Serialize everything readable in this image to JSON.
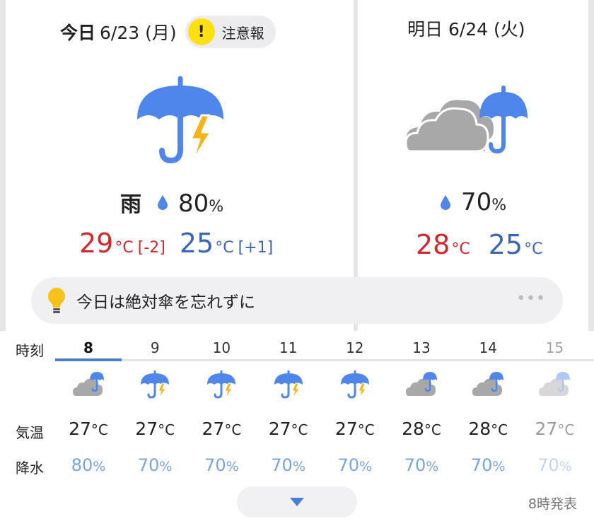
{
  "today": {
    "label": "今日",
    "date": "6/23 (月)",
    "alert": {
      "icon": "exclamation-icon",
      "label": "注意報"
    },
    "icon": "umbrella-lightning-icon",
    "weather": "雨",
    "pop": "80",
    "pop_unit": "%",
    "high": "29",
    "high_diff": "[-2]",
    "low": "25",
    "low_diff": "[+1]",
    "temp_unit": "°C"
  },
  "tomorrow": {
    "date": "明日 6/24 (火)",
    "icon": "cloud-umbrella-icon",
    "pop": "70",
    "pop_unit": "%",
    "high": "28",
    "low": "25",
    "temp_unit": "°C"
  },
  "tip": {
    "icon": "lightbulb-icon",
    "text": "今日は絶対傘を忘れずに",
    "more": "•••"
  },
  "hourly": {
    "time_label": "時刻",
    "temp_label": "気温",
    "precip_label": "降水",
    "hours": [
      {
        "hour": "8",
        "icon": "cloud-umbrella-icon",
        "temp": "27",
        "pop": "80"
      },
      {
        "hour": "9",
        "icon": "umbrella-lightning-icon",
        "temp": "27",
        "pop": "70"
      },
      {
        "hour": "10",
        "icon": "umbrella-lightning-icon",
        "temp": "27",
        "pop": "70"
      },
      {
        "hour": "11",
        "icon": "umbrella-lightning-icon",
        "temp": "27",
        "pop": "70"
      },
      {
        "hour": "12",
        "icon": "umbrella-lightning-icon",
        "temp": "27",
        "pop": "70"
      },
      {
        "hour": "13",
        "icon": "cloud-umbrella-icon",
        "temp": "28",
        "pop": "70"
      },
      {
        "hour": "14",
        "icon": "cloud-umbrella-icon",
        "temp": "28",
        "pop": "70"
      },
      {
        "hour": "15",
        "icon": "cloud-umbrella-icon",
        "temp": "27",
        "pop": "70"
      }
    ],
    "temp_unit": "°C",
    "pop_unit": "%"
  },
  "footer": {
    "issued": "8時発表",
    "expand_icon": "caret-down-icon"
  },
  "colors": {
    "high": "#d0282d",
    "low": "#3a66b5",
    "umbrella": "#4f86ec",
    "lightning": "#f4b41a",
    "cloud": "#a8a8a8",
    "accent": "#4a7fd6",
    "alert": "#ffdf10"
  }
}
